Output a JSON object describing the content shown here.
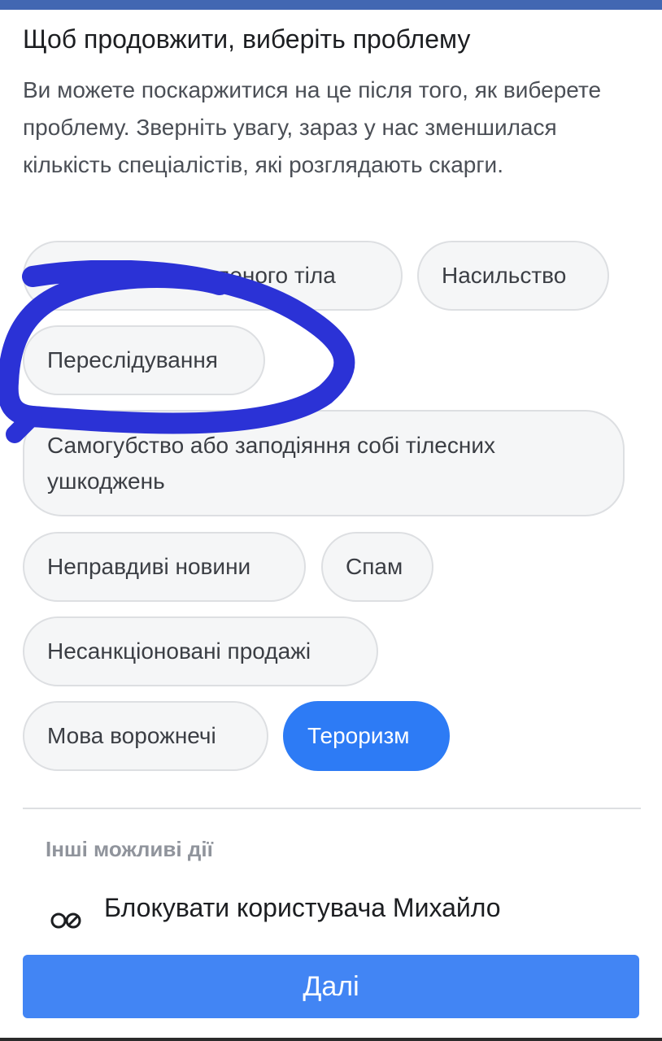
{
  "header": {
    "title": "Щоб продовжити, виберіть проблему",
    "description": "Ви можете поскаржитися на це після того, як виберете проблему. Зверніть увагу, зараз у нас зменшилася кількість спеціалістів, які розглядають скарги."
  },
  "problems": [
    {
      "label": "Зображення оголеного тіла",
      "selected": false
    },
    {
      "label": "Насильство",
      "selected": false
    },
    {
      "label": "Переслідування",
      "selected": false
    },
    {
      "label": "Самогубство або заподіяння собі тілесних ушкоджень",
      "selected": false
    },
    {
      "label": "Неправдиві новини",
      "selected": false
    },
    {
      "label": "Спам",
      "selected": false
    },
    {
      "label": "Несанкціоновані продажі",
      "selected": false
    },
    {
      "label": "Мова ворожнечі",
      "selected": false
    },
    {
      "label": "Тероризм",
      "selected": true
    }
  ],
  "other_actions": {
    "heading": "Інші можливі дії",
    "block_user_label": "Блокувати користувача Михайло"
  },
  "footer": {
    "next_label": "Далі"
  },
  "colors": {
    "accent": "#4285f4",
    "selected_chip": "#2d7bf5",
    "top_bar": "#4267b2",
    "annotation": "#2b32d6"
  },
  "icons": {
    "block": "block-user-icon"
  }
}
